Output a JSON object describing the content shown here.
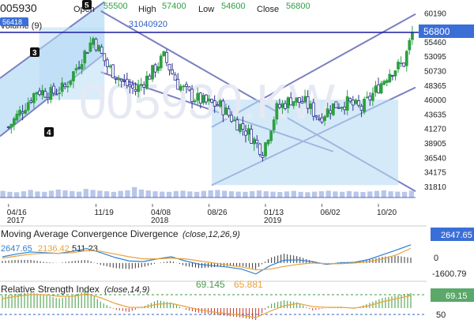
{
  "header": {
    "symbol": "005930",
    "open_label": "Open",
    "open_value": "55500",
    "high_label": "High",
    "high_value": "57400",
    "low_label": "Low",
    "low_value": "54600",
    "close_label": "Close",
    "close_value": "56800",
    "volume_label": "Volume (9)",
    "volume_value": "31040920",
    "volume_badge": "56418",
    "watermark": "005930.KW"
  },
  "colors": {
    "up": "#2ea043",
    "down": "#2b2f8f",
    "channel": "#7b80c0",
    "channel_fill": "#b9dcf5",
    "price_line": "#1a1aa0",
    "macd_line": "#2f80d0",
    "signal_line": "#e8a23c",
    "rsi_line": "#e8a23c",
    "hist_up": "#3a9a3a",
    "hist_down": "#c0392b"
  },
  "annotations": [
    {
      "label": "3",
      "date": "2017-07-10"
    },
    {
      "label": "4",
      "date": "2017-07-10"
    },
    {
      "label": "5",
      "date": "2017-11-06"
    }
  ],
  "chart_data": [
    {
      "type": "line",
      "panel": "price",
      "title": "",
      "xlabel": "",
      "ylabel": "",
      "x_ticks": [
        "04/16",
        "11/19",
        "04/08",
        "08/26",
        "01/13",
        "06/02",
        "10/20"
      ],
      "x_year_labels": [
        {
          "at": "04/16",
          "year": "2017"
        },
        {
          "at": "04/08",
          "year": "2018"
        },
        {
          "at": "01/13",
          "year": "2019"
        }
      ],
      "y_ticks": [
        60190,
        57825,
        55460,
        53095,
        50730,
        48365,
        46000,
        43635,
        41270,
        38905,
        36540,
        34175,
        31810
      ],
      "ylim": [
        30500,
        61000
      ],
      "last_price": 56800,
      "series": [
        {
          "values": [
            {
              "x": "2017-04-16",
              "y": 41500
            },
            {
              "x": "2017-05-21",
              "y": 44500
            },
            {
              "x": "2017-06-25",
              "y": 47500
            },
            {
              "x": "2017-07-30",
              "y": 47000
            },
            {
              "x": "2017-09-03",
              "y": 48000
            },
            {
              "x": "2017-10-08",
              "y": 52000
            },
            {
              "x": "2017-11-12",
              "y": 56000
            },
            {
              "x": "2017-12-17",
              "y": 51500
            },
            {
              "x": "2018-01-21",
              "y": 49000
            },
            {
              "x": "2018-02-25",
              "y": 47500
            },
            {
              "x": "2018-04-01",
              "y": 50000
            },
            {
              "x": "2018-05-06",
              "y": 53000
            },
            {
              "x": "2018-06-10",
              "y": 48500
            },
            {
              "x": "2018-07-15",
              "y": 46500
            },
            {
              "x": "2018-08-19",
              "y": 45500
            },
            {
              "x": "2018-09-23",
              "y": 45000
            },
            {
              "x": "2018-10-28",
              "y": 42500
            },
            {
              "x": "2018-12-02",
              "y": 40500
            },
            {
              "x": "2019-01-06",
              "y": 37500
            },
            {
              "x": "2019-02-10",
              "y": 44500
            },
            {
              "x": "2019-03-17",
              "y": 46000
            },
            {
              "x": "2019-04-21",
              "y": 45500
            },
            {
              "x": "2019-05-26",
              "y": 43000
            },
            {
              "x": "2019-06-30",
              "y": 45000
            },
            {
              "x": "2019-08-04",
              "y": 45500
            },
            {
              "x": "2019-09-08",
              "y": 44500
            },
            {
              "x": "2019-10-13",
              "y": 47500
            },
            {
              "x": "2019-11-17",
              "y": 50500
            },
            {
              "x": "2019-12-22",
              "y": 52000
            },
            {
              "x": "2020-01-12",
              "y": 56800
            }
          ]
        }
      ]
    },
    {
      "type": "bar",
      "panel": "volume",
      "values": [
        0.35,
        0.3,
        0.28,
        0.33,
        0.4,
        0.32,
        0.3,
        0.36,
        0.42,
        0.38,
        0.34,
        0.31,
        0.45,
        0.4,
        0.36,
        0.33,
        0.3,
        0.35,
        0.38,
        0.55,
        0.42,
        0.37,
        0.33,
        0.31,
        0.3,
        0.34,
        0.36,
        0.32,
        0.3,
        0.35,
        0.38,
        0.4,
        0.36,
        0.33,
        0.31,
        0.3,
        0.34,
        0.37,
        0.33,
        0.31,
        0.29,
        0.32,
        0.35,
        0.3,
        0.28,
        0.31,
        0.33,
        0.36,
        0.32,
        0.3,
        0.34,
        0.31,
        0.29,
        0.32,
        0.35,
        0.38,
        0.33,
        0.31,
        0.3,
        0.36
      ]
    },
    {
      "type": "line",
      "panel": "macd",
      "title": "Moving Average Convergence Divergence",
      "params": "(close,12,26,9)",
      "macd_value": "2647.65",
      "signal_value": "2136.42",
      "hist_value": "511.23",
      "badge_value": "2647.65",
      "y_ticks": [
        0,
        -1600.79
      ],
      "ylim": [
        -2200,
        3200
      ],
      "x": [
        0,
        1,
        2,
        3,
        4,
        5,
        6,
        7,
        8,
        9,
        10,
        11,
        12,
        13,
        14,
        15,
        16,
        17,
        18,
        19,
        20,
        21,
        22,
        23,
        24,
        25,
        26,
        27,
        28,
        29
      ],
      "series": [
        {
          "name": "macd",
          "values": [
            900,
            1300,
            1600,
            1500,
            1400,
            1700,
            2100,
            1500,
            800,
            300,
            200,
            600,
            900,
            300,
            -200,
            -400,
            -600,
            -900,
            -1600,
            -400,
            400,
            450,
            200,
            -200,
            0,
            100,
            500,
            1200,
            1900,
            2647
          ]
        },
        {
          "name": "signal",
          "values": [
            700,
            1000,
            1300,
            1400,
            1400,
            1500,
            1800,
            1700,
            1300,
            900,
            600,
            600,
            700,
            600,
            300,
            0,
            -300,
            -600,
            -1000,
            -900,
            -500,
            -200,
            0,
            -100,
            -100,
            0,
            200,
            600,
            1200,
            2136
          ]
        }
      ]
    },
    {
      "type": "line",
      "panel": "rsi",
      "title": "Relative Strength Index",
      "params": "(close,14,9)",
      "rsi_value": "69.145",
      "signal_value": "65.881",
      "badge_value": "69.15",
      "y_ticks": [
        50
      ],
      "ylim": [
        20,
        80
      ],
      "x": [
        0,
        1,
        2,
        3,
        4,
        5,
        6,
        7,
        8,
        9,
        10,
        11,
        12,
        13,
        14,
        15,
        16,
        17,
        18,
        19,
        20,
        21,
        22,
        23,
        24,
        25,
        26,
        27,
        28,
        29
      ],
      "series": [
        {
          "name": "rsi",
          "values": [
            66,
            68,
            70,
            67,
            62,
            66,
            72,
            58,
            48,
            45,
            52,
            60,
            57,
            48,
            44,
            42,
            40,
            38,
            35,
            55,
            60,
            57,
            47,
            50,
            52,
            49,
            56,
            63,
            66,
            69.145
          ]
        },
        {
          "name": "signal",
          "values": [
            62,
            65,
            67,
            67,
            65,
            65,
            68,
            63,
            56,
            51,
            51,
            55,
            56,
            52,
            48,
            45,
            43,
            41,
            38,
            46,
            53,
            56,
            52,
            51,
            51,
            50,
            53,
            58,
            62,
            65.881
          ]
        }
      ]
    }
  ]
}
